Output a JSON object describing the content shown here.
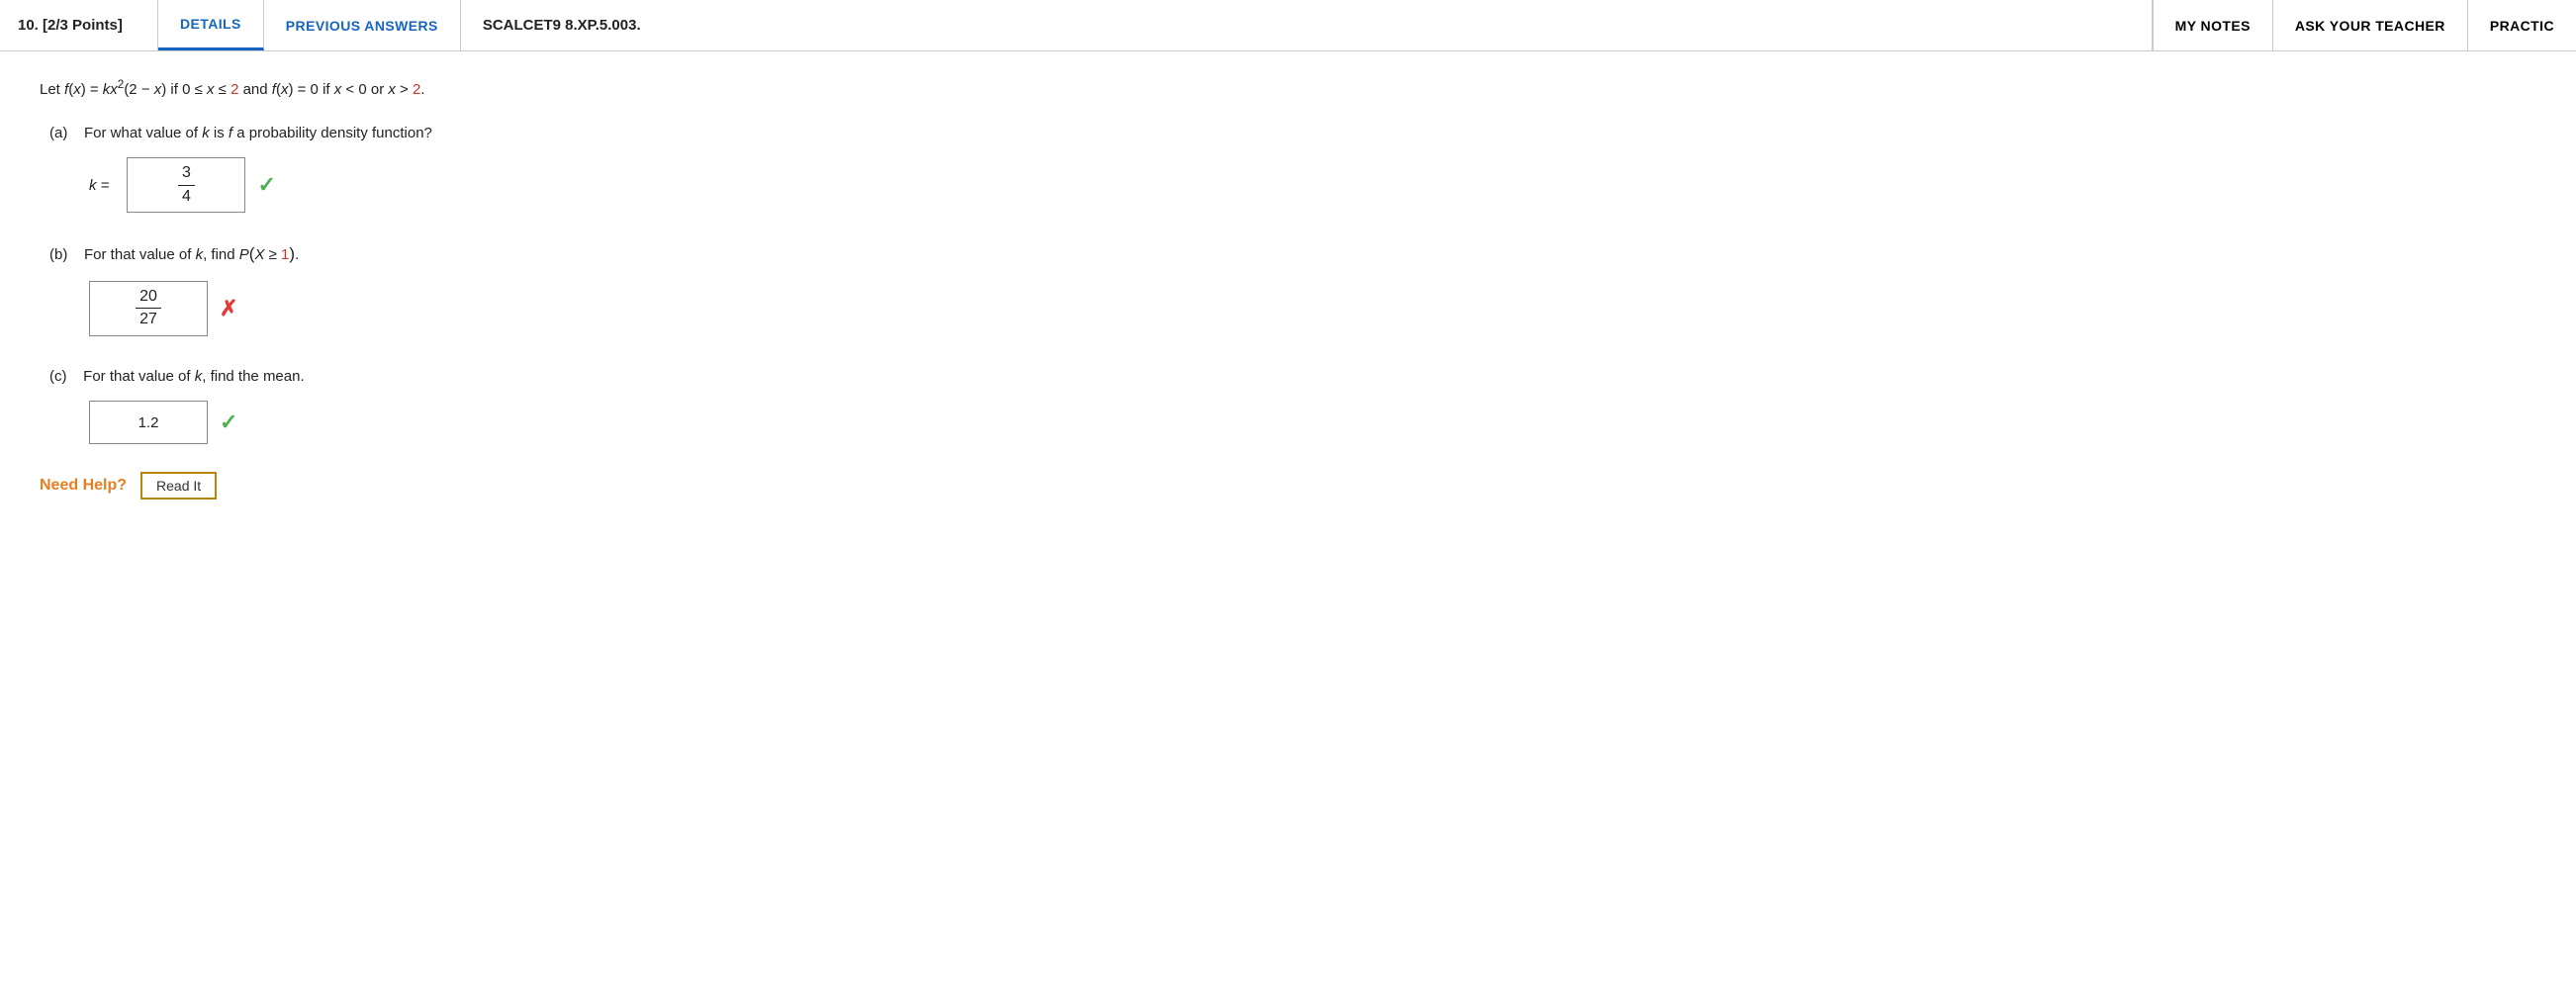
{
  "header": {
    "question_num": "10.",
    "points": "[2/3 Points]",
    "btn_details": "DETAILS",
    "btn_previous": "PREVIOUS ANSWERS",
    "problem_id": "SCALCET9 8.XP.5.003.",
    "btn_my_notes": "MY NOTES",
    "btn_ask_teacher": "ASK YOUR TEACHER",
    "btn_practice": "PRACTIC"
  },
  "problem": {
    "description_part1": "Let f(x) = kx",
    "description_part2": "2",
    "description_part3": "(2 − x) if 0 ≤ x ≤ 2 and f(x) = 0 if x < 0 or x > 2.",
    "part_a": {
      "label": "(a)",
      "question": "For what value of k is f a probability density function?",
      "k_label": "k =",
      "answer_numerator": "3",
      "answer_denominator": "4",
      "status": "correct"
    },
    "part_b": {
      "label": "(b)",
      "question_prefix": "For that value of k, find P",
      "question_paren": "X ≥ 1",
      "answer_numerator": "20",
      "answer_denominator": "27",
      "status": "incorrect"
    },
    "part_c": {
      "label": "(c)",
      "question": "For that value of k, find the mean.",
      "answer": "1.2",
      "status": "correct"
    }
  },
  "help": {
    "need_help_label": "Need Help?",
    "read_it_btn": "Read It"
  },
  "icons": {
    "check": "✓",
    "cross": "✗"
  }
}
